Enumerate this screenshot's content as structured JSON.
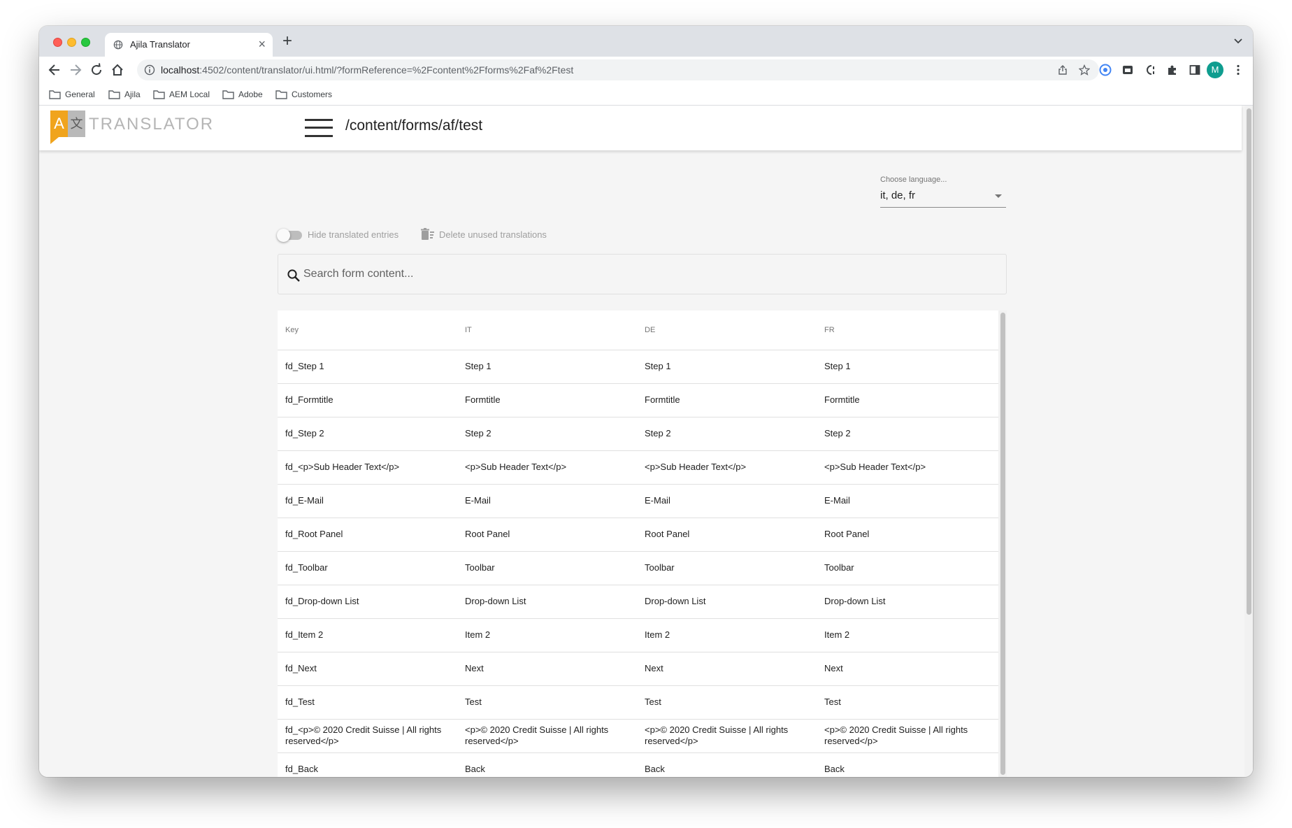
{
  "browser": {
    "tab_title": "Ajila Translator",
    "tab_close": "×",
    "new_tab": "+",
    "url_host": "localhost",
    "url_rest": ":4502/content/translator/ui.html/?formReference=%2Fcontent%2Fforms%2Faf%2Ftest",
    "avatar_letter": "M",
    "bookmarks": [
      {
        "label": "General"
      },
      {
        "label": "Ajila"
      },
      {
        "label": "AEM Local"
      },
      {
        "label": "Adobe"
      },
      {
        "label": "Customers"
      }
    ]
  },
  "app": {
    "logo_a": "A",
    "logo_x": "文",
    "logo_text": "TRANSLATOR",
    "page_path": "/content/forms/af/test",
    "language": {
      "label": "Choose language...",
      "value": "it, de, fr"
    },
    "options": {
      "hide_translated": "Hide translated entries",
      "hide_translated_on": false,
      "delete_unused": "Delete unused translations"
    },
    "search": {
      "placeholder": "Search form content..."
    },
    "table": {
      "headers": [
        "Key",
        "IT",
        "DE",
        "FR"
      ],
      "rows": [
        [
          "fd_Step 1",
          "Step 1",
          "Step 1",
          "Step 1"
        ],
        [
          "fd_Formtitle",
          "Formtitle",
          "Formtitle",
          "Formtitle"
        ],
        [
          "fd_Step 2",
          "Step 2",
          "Step 2",
          "Step 2"
        ],
        [
          "fd_<p>Sub Header Text</p>",
          "<p>Sub Header Text</p>",
          "<p>Sub Header Text</p>",
          "<p>Sub Header Text</p>"
        ],
        [
          "fd_E-Mail",
          "E-Mail",
          "E-Mail",
          "E-Mail"
        ],
        [
          "fd_Root Panel",
          "Root Panel",
          "Root Panel",
          "Root Panel"
        ],
        [
          "fd_Toolbar",
          "Toolbar",
          "Toolbar",
          "Toolbar"
        ],
        [
          "fd_Drop-down List",
          "Drop-down List",
          "Drop-down List",
          "Drop-down List"
        ],
        [
          "fd_Item 2",
          "Item 2",
          "Item 2",
          "Item 2"
        ],
        [
          "fd_Next",
          "Next",
          "Next",
          "Next"
        ],
        [
          "fd_Test",
          "Test",
          "Test",
          "Test"
        ],
        [
          "fd_<p>© 2020 Credit Suisse | All rights reserved</p>",
          "<p>© 2020 Credit Suisse | All rights reserved</p>",
          "<p>© 2020 Credit Suisse | All rights reserved</p>",
          "<p>© 2020 Credit Suisse | All rights reserved</p>"
        ],
        [
          "fd_Back",
          "Back",
          "Back",
          "Back"
        ]
      ]
    }
  }
}
